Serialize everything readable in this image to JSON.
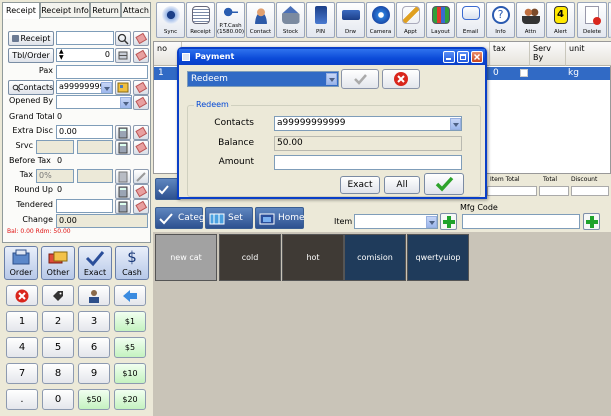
{
  "tabs": [
    "Receipt",
    "Receipt Info",
    "Return",
    "Attach"
  ],
  "left": {
    "receipt_btn": "Receipt",
    "tbl_order_btn": "Tbl/Order",
    "tbl_order_value": "0",
    "pax_label": "Pax",
    "contacts_btn": "Contacts",
    "contacts_value": "a99999999",
    "opened_by_label": "Opened By",
    "grand_total_label": "Grand Total",
    "grand_total_value": "0",
    "extra_disc_label": "Extra Disc",
    "extra_disc_value": "0.00",
    "srvc_label": "Srvc",
    "before_tax_label": "Before Tax",
    "before_tax_value": "0",
    "tax_label": "Tax",
    "tax_value": "0%",
    "round_up_label": "Round Up",
    "round_up_value": "0",
    "tendered_label": "Tendered",
    "change_label": "Change",
    "change_value": "0.00",
    "balance_note": "Bal: 0.00 Rdm: 50.00"
  },
  "actions": {
    "order": "Order",
    "other": "Other",
    "exact": "Exact",
    "cash": "Cash"
  },
  "keypad": {
    "k1": "1",
    "k2": "2",
    "k3": "3",
    "k4": "4",
    "k5": "5",
    "k6": "6",
    "k7": "7",
    "k8": "8",
    "k9": "9",
    "k0": "0",
    "kdot": ".",
    "c1": "$1",
    "c5": "$5",
    "c10": "$10",
    "c20": "$20",
    "c50": "$50"
  },
  "toolbar": {
    "sync": "Sync",
    "receipt": "Receipt",
    "ptcash": "P.T.Cash",
    "ptcash_amount": "(1580.00)",
    "contact": "Contact",
    "stock": "Stock",
    "pin": "PIN",
    "drw": "Drw",
    "camera": "Camera",
    "appt": "Appt",
    "layout": "Layout",
    "email": "Email",
    "info": "Info",
    "attn": "Attn",
    "alert": "Alert",
    "alert_count": "4",
    "new_badge": "NEW",
    "delete": "Delete"
  },
  "grid": {
    "headers": {
      "no": "no",
      "tax": "tax",
      "serv_by": "Serv By",
      "unit": "unit"
    },
    "row": {
      "no": "1",
      "tax": "0",
      "unit": "kg"
    }
  },
  "summary": {
    "item_total": "Item Total",
    "total": "Total",
    "discount": "Discount"
  },
  "nav": {
    "category": "Category",
    "set": "Set",
    "home": "Home",
    "mfg_code_label": "Mfg Code",
    "item_label": "Item"
  },
  "products": [
    {
      "label": "new cat",
      "color": "#a2a2a2"
    },
    {
      "label": "cold",
      "color": "#3f3a35"
    },
    {
      "label": "hot",
      "color": "#3f3a35"
    },
    {
      "label": "comision",
      "color": "#1f3b5b"
    },
    {
      "label": "qwertyuiop",
      "color": "#1f3b5b"
    }
  ],
  "dialog": {
    "title": "Payment",
    "method": "Redeem",
    "group_title": "Redeem",
    "contacts_label": "Contacts",
    "contacts_value": "a99999999999",
    "balance_label": "Balance",
    "balance_value": "50.00",
    "amount_label": "Amount",
    "amount_value": "",
    "exact_btn": "Exact",
    "all_btn": "All"
  },
  "colors": {
    "selection": "#316ac5",
    "titlebar": "#0a3fc7",
    "cash_green": "#c4f2c0",
    "danger_red": "#d9261c"
  }
}
